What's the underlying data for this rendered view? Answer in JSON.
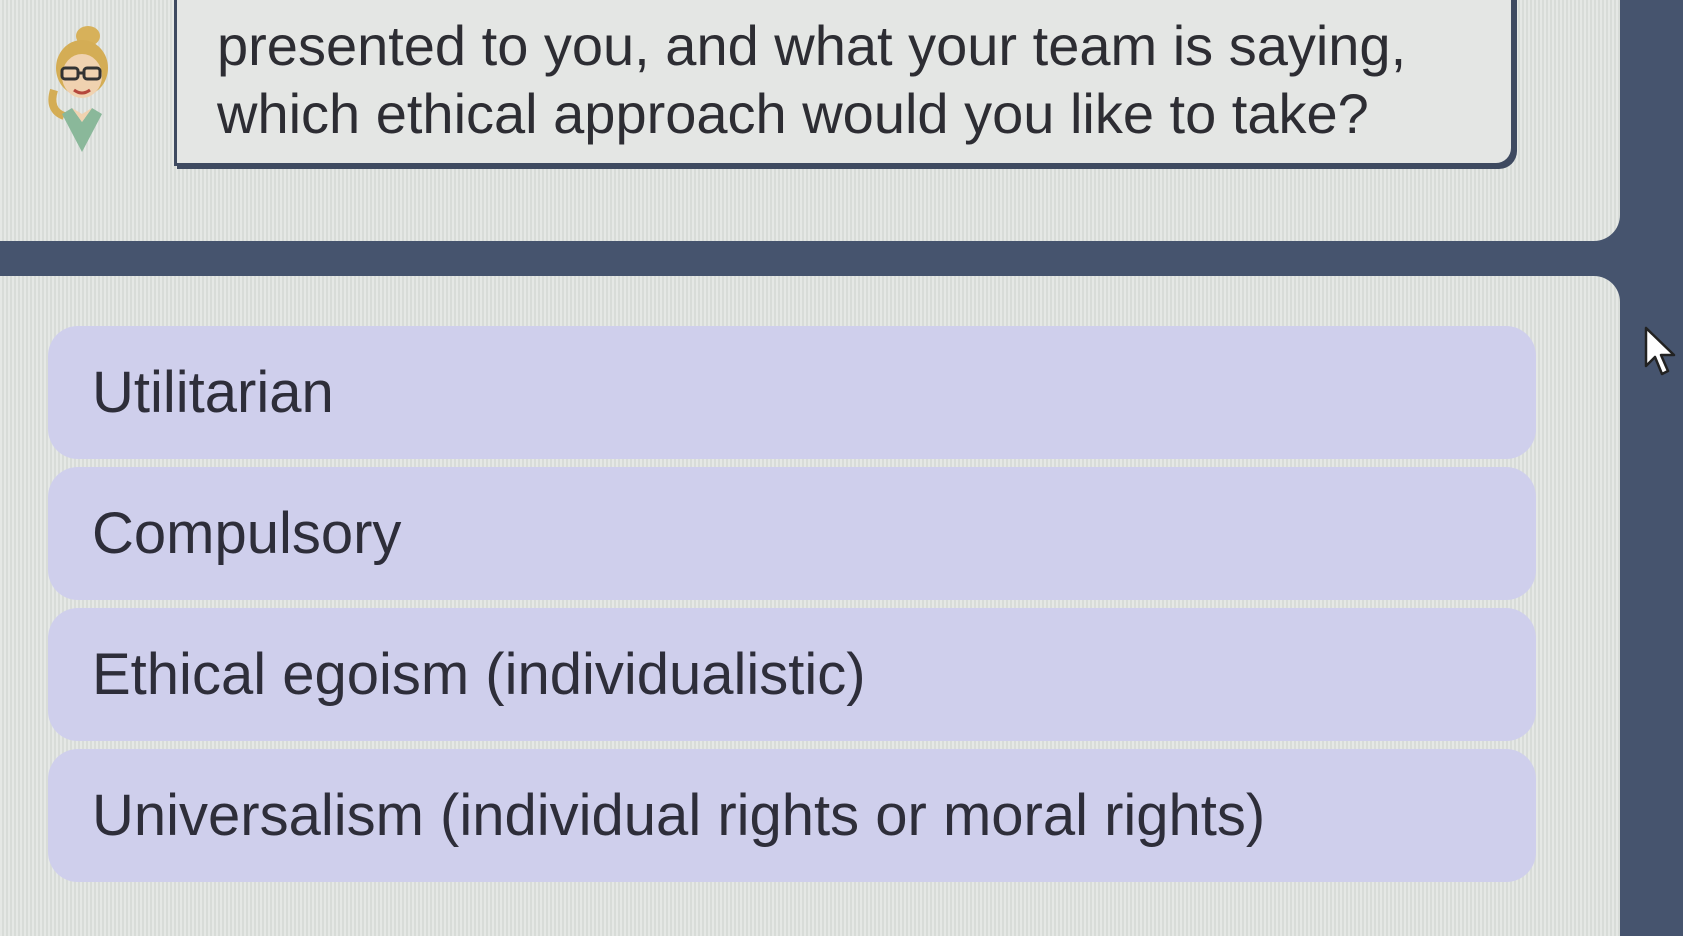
{
  "question": {
    "line1": "presented to you, and what your team is saying,",
    "line2": "which ethical approach would you like to take?"
  },
  "options": [
    {
      "label": "Utilitarian"
    },
    {
      "label": "Compulsory"
    },
    {
      "label": "Ethical egoism (individualistic)"
    },
    {
      "label": "Universalism (individual rights or moral rights)"
    }
  ],
  "icons": {
    "avatar": "character-avatar-icon",
    "cursor": "mouse-cursor-icon"
  },
  "colors": {
    "frame": "#46546e",
    "panel": "#dfe3df",
    "option_background": "#cfcfec",
    "text": "#2e2e3a"
  }
}
